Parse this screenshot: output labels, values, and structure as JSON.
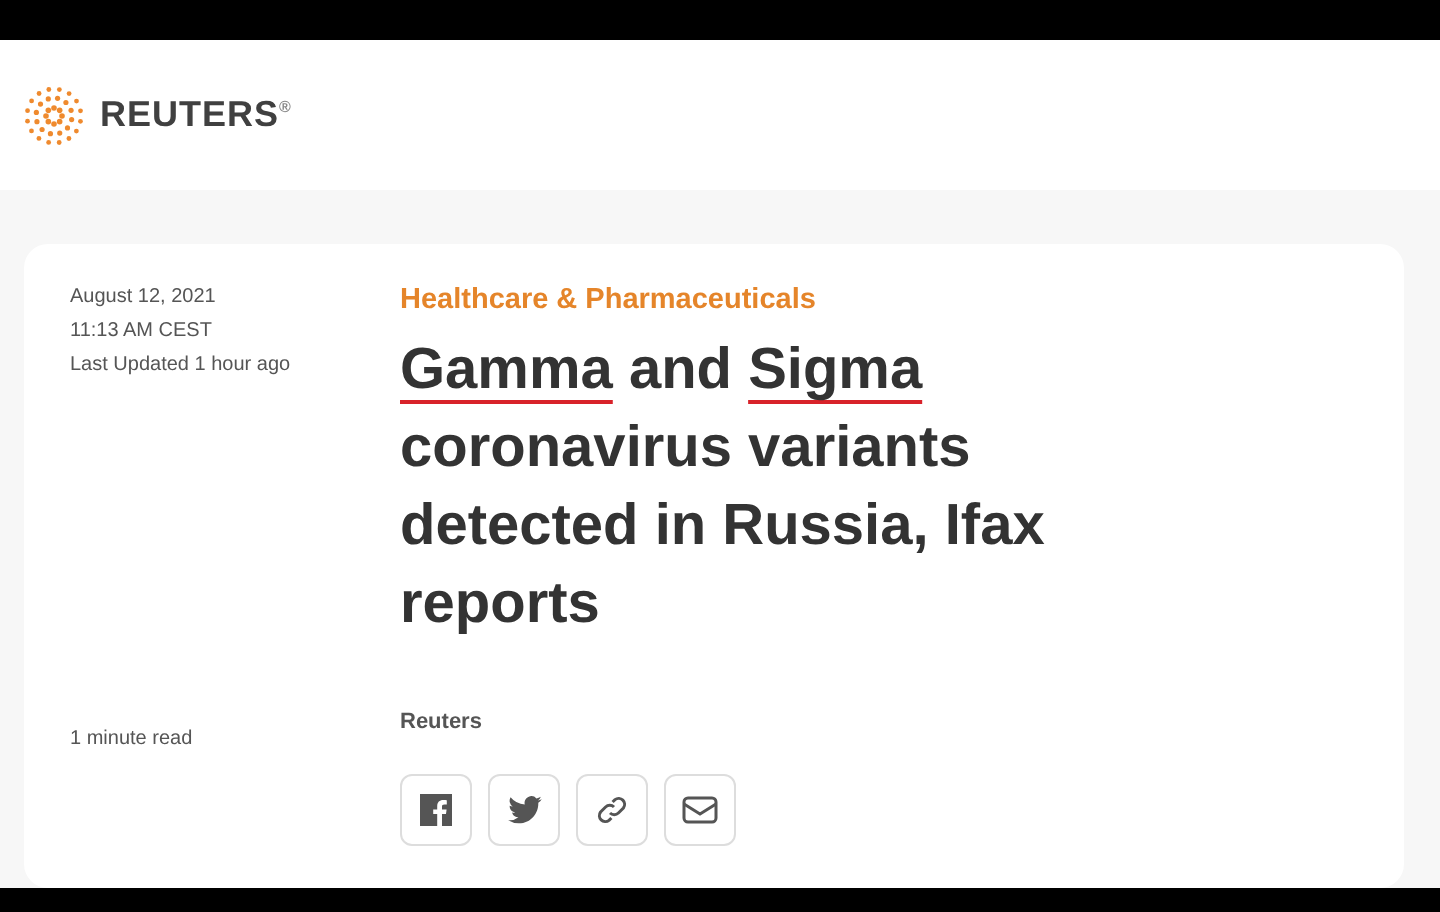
{
  "brand": {
    "name": "REUTERS",
    "mark": "®"
  },
  "article": {
    "date": "August 12, 2021",
    "time": "11:13 AM CEST",
    "updated": "Last Updated 1 hour ago",
    "read_time": "1 minute read",
    "category": "Healthcare & Pharmaceuticals",
    "headline": [
      {
        "text": "Gamma",
        "marked": true
      },
      {
        "text": " and ",
        "marked": false
      },
      {
        "text": "Sigma",
        "marked": true
      },
      {
        "text": " coronavirus variants detected in Russia, Ifax reports",
        "marked": false
      }
    ],
    "byline": "Reuters",
    "share": [
      {
        "kind": "facebook"
      },
      {
        "kind": "twitter"
      },
      {
        "kind": "link"
      },
      {
        "kind": "email"
      }
    ]
  }
}
